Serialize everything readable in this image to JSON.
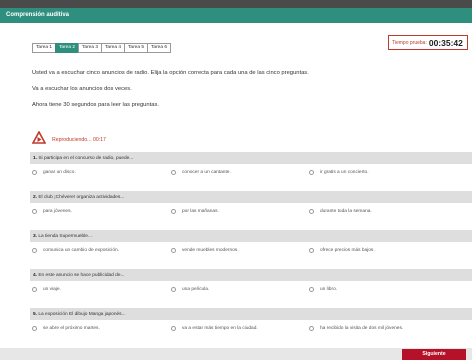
{
  "window": {
    "title": "Comprensión auditiva"
  },
  "tabs": [
    {
      "label": "Tarea 1",
      "active": false
    },
    {
      "label": "Tarea 2",
      "active": true
    },
    {
      "label": "Tarea 3",
      "active": false
    },
    {
      "label": "Tarea 4",
      "active": false
    },
    {
      "label": "Tarea 5",
      "active": false
    },
    {
      "label": "Tarea 6",
      "active": false
    }
  ],
  "timer": {
    "label": "Tiempo prueba:",
    "value": "00:35:42"
  },
  "instructions": [
    "Usted va a escuchar cinco anuncios de radio. Elija la opción correcta para cada una de las cinco preguntas.",
    "Va a escuchar los anuncios dos veces.",
    "Ahora tiene 30 segundos para leer las preguntas."
  ],
  "player": {
    "status": "Reproduciendo... 00:17",
    "icon": "play-triangle-icon",
    "color": "#c0392b"
  },
  "questions": [
    {
      "number": "1.",
      "text": "Si participa en el concurso de radio, puede...",
      "options": [
        "ganar un disco.",
        "conocer a un cantante.",
        "ir gratis a un concierto."
      ]
    },
    {
      "number": "2.",
      "text": "El club ¡Chévere! organiza actividades...",
      "options": [
        "para jóvenes.",
        "por las mañanas.",
        "durante toda la semana."
      ]
    },
    {
      "number": "3.",
      "text": "La tienda Supermueble...",
      "options": [
        "comunica un cambio de exposición.",
        "vende muebles modernos.",
        "ofrece precios más bajos."
      ]
    },
    {
      "number": "4.",
      "text": "En este anuncio se hace publicidad de...",
      "options": [
        "un viaje.",
        "una película.",
        "un libro."
      ]
    },
    {
      "number": "5.",
      "text": "La exposición El dibujo Manga japonés...",
      "options": [
        "se abre el próximo martes.",
        "va a estar más tiempo en la ciudad.",
        "ha recibido la visita de dos mil jóvenes."
      ]
    }
  ],
  "footer": {
    "next_label": "Siguiente"
  },
  "colors": {
    "accent": "#2f8f7e",
    "alert": "#c0392b",
    "next_button": "#b5122a"
  }
}
